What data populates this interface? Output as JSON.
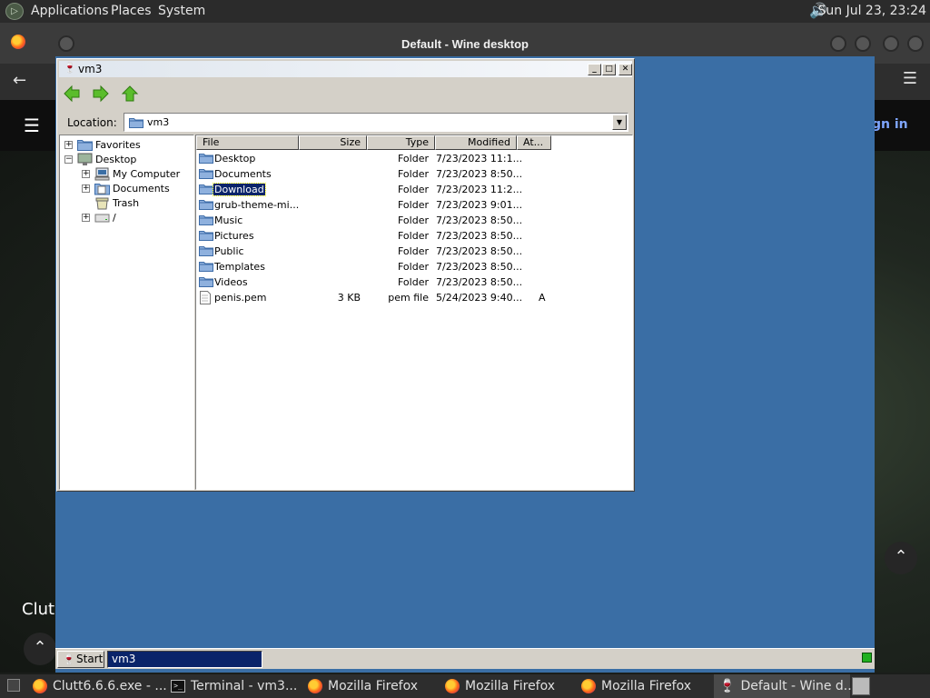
{
  "top_panel": {
    "menus": [
      "Applications",
      "Places",
      "System"
    ],
    "clock": "Sun Jul 23, 23:24"
  },
  "background_app": {
    "wine_window_title": "Default - Wine desktop",
    "sign_in_text": "gn in",
    "partial_text": "Clut"
  },
  "explorer": {
    "title": "vm3",
    "toolbar": {
      "back_icon": "green-left-arrow",
      "forward_icon": "green-right-arrow",
      "up_icon": "green-up-arrow"
    },
    "location_label": "Location:",
    "location_value": "vm3",
    "tree": [
      {
        "label": "Favorites",
        "expander": "+",
        "icon": "folder"
      },
      {
        "label": "Desktop",
        "expander": "−",
        "icon": "desktop"
      },
      {
        "label": "My Computer",
        "expander": "+",
        "icon": "computer"
      },
      {
        "label": "Documents",
        "expander": "+",
        "icon": "documents"
      },
      {
        "label": "Trash",
        "expander": "",
        "icon": "trash"
      },
      {
        "label": "/",
        "expander": "+",
        "icon": "drive"
      }
    ],
    "columns": [
      "File",
      "Size",
      "Type",
      "Modified",
      "At..."
    ],
    "files": [
      {
        "name": "Desktop",
        "size": "",
        "type": "Folder",
        "modified": "7/23/2023 11:1...",
        "attr": "",
        "icon": "folder"
      },
      {
        "name": "Documents",
        "size": "",
        "type": "Folder",
        "modified": "7/23/2023 8:50...",
        "attr": "",
        "icon": "folder"
      },
      {
        "name": "Download",
        "size": "",
        "type": "Folder",
        "modified": "7/23/2023 11:2...",
        "attr": "",
        "icon": "folder",
        "selected": true
      },
      {
        "name": "grub-theme-mi...",
        "size": "",
        "type": "Folder",
        "modified": "7/23/2023 9:01...",
        "attr": "",
        "icon": "folder"
      },
      {
        "name": "Music",
        "size": "",
        "type": "Folder",
        "modified": "7/23/2023 8:50...",
        "attr": "",
        "icon": "folder"
      },
      {
        "name": "Pictures",
        "size": "",
        "type": "Folder",
        "modified": "7/23/2023 8:50...",
        "attr": "",
        "icon": "folder"
      },
      {
        "name": "Public",
        "size": "",
        "type": "Folder",
        "modified": "7/23/2023 8:50...",
        "attr": "",
        "icon": "folder"
      },
      {
        "name": "Templates",
        "size": "",
        "type": "Folder",
        "modified": "7/23/2023 8:50...",
        "attr": "",
        "icon": "folder"
      },
      {
        "name": "Videos",
        "size": "",
        "type": "Folder",
        "modified": "7/23/2023 8:50...",
        "attr": "",
        "icon": "folder"
      },
      {
        "name": "penis.pem",
        "size": "3 KB",
        "type": "pem file",
        "modified": "5/24/2023 9:40...",
        "attr": "A",
        "icon": "file"
      }
    ]
  },
  "wine_taskbar": {
    "start_label": "Start",
    "task_label": "vm3"
  },
  "bottom_panel": {
    "items": [
      {
        "label": "Clutt6.6.6.exe - ...",
        "icon": "firefox"
      },
      {
        "label": "Terminal - vm3...",
        "icon": "terminal"
      },
      {
        "label": "Mozilla Firefox",
        "icon": "firefox"
      },
      {
        "label": "Mozilla Firefox",
        "icon": "firefox"
      },
      {
        "label": "Mozilla Firefox",
        "icon": "firefox"
      },
      {
        "label": "Default - Wine d...",
        "icon": "wine",
        "active": true
      }
    ]
  },
  "colors": {
    "wine_desktop": "#3a6ea5",
    "selection": "#0a246a",
    "window_face": "#d4d0c8"
  }
}
